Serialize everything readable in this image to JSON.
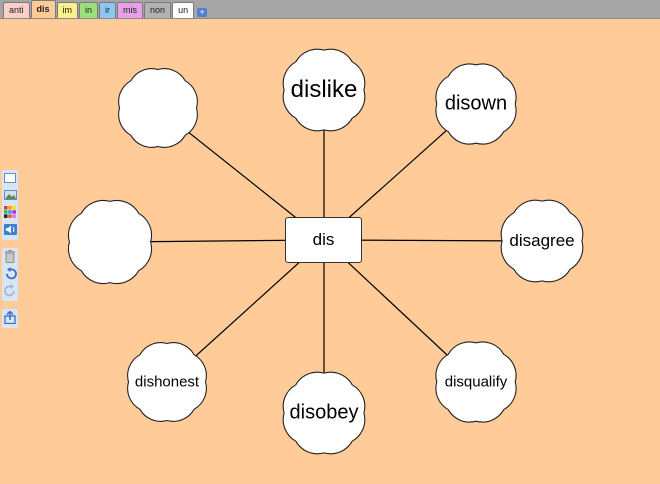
{
  "tabs": [
    {
      "label": "anti",
      "color": "#FBD0C8",
      "active": false
    },
    {
      "label": "dis",
      "color": "#FFCB99",
      "active": true
    },
    {
      "label": "im",
      "color": "#FAF18B",
      "active": false
    },
    {
      "label": "in",
      "color": "#9DE07A",
      "active": false
    },
    {
      "label": "ir",
      "color": "#8BC9F2",
      "active": false
    },
    {
      "label": "mis",
      "color": "#E8A0E8",
      "active": false
    },
    {
      "label": "non",
      "color": "#B3B3B3",
      "active": false
    },
    {
      "label": "un",
      "color": "#FFFFFF",
      "active": false
    }
  ],
  "add_tab_label": "+",
  "toolbar": {
    "icons": [
      "rectangle-icon",
      "image-icon",
      "color-palette-icon",
      "sound-icon",
      "trash-icon",
      "undo-icon",
      "redo-icon",
      "share-icon"
    ]
  },
  "map": {
    "center": "dis",
    "clouds": [
      {
        "word": ""
      },
      {
        "word": "dislike"
      },
      {
        "word": "disown"
      },
      {
        "word": ""
      },
      {
        "word": "disagree"
      },
      {
        "word": "dishonest"
      },
      {
        "word": "disobey"
      },
      {
        "word": "disqualify"
      }
    ]
  },
  "colors": {
    "background": "#FFCB99",
    "tabbar": "#A5A5A5",
    "cloud_fill": "#FFFFFF",
    "line": "#000000"
  }
}
